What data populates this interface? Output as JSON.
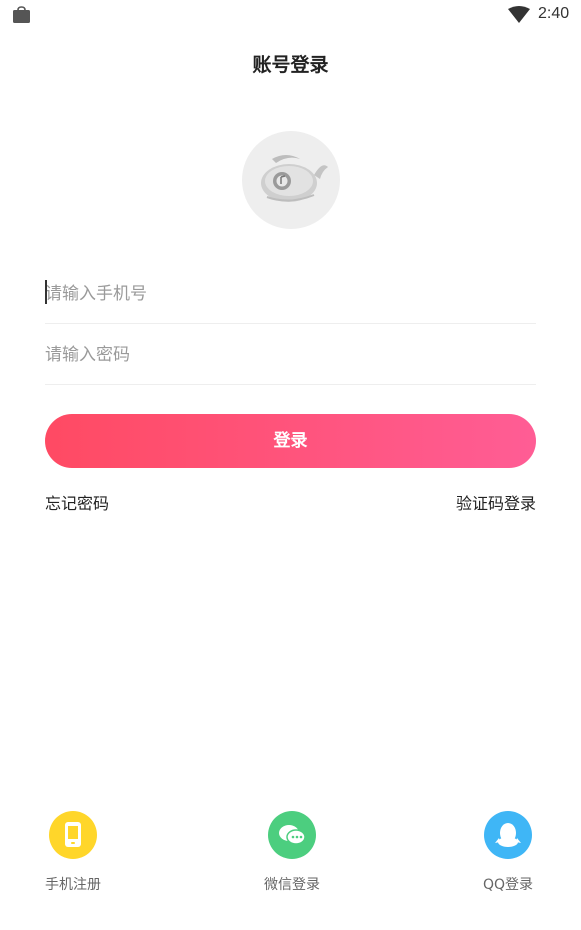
{
  "status_bar": {
    "time": "2:40",
    "icons": [
      "bag-icon",
      "wifi-icon"
    ]
  },
  "header": {
    "title": "账号登录"
  },
  "form": {
    "phone_placeholder": "请输入手机号",
    "password_placeholder": "请输入密码",
    "login_label": "登录",
    "forgot_label": "忘记密码",
    "code_login_label": "验证码登录"
  },
  "social": {
    "register_label": "手机注册",
    "wechat_label": "微信登录",
    "qq_label": "QQ登录"
  },
  "colors": {
    "accent_start": "#ff4a63",
    "accent_end": "#ff5d95",
    "register": "#ffd62a",
    "wechat": "#4cce7f",
    "qq": "#3fb6f6"
  }
}
